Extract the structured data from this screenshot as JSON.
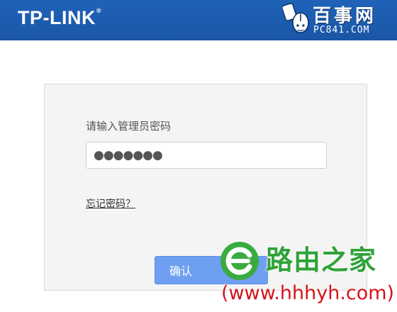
{
  "header": {
    "brand": "TP-LINK",
    "brand_mark": "®",
    "bg_color": "#1a56a6"
  },
  "watermark_top": {
    "icon": "mouse-icon",
    "title": "百事网",
    "subtitle": "PC841.COM"
  },
  "login": {
    "prompt": "请输入管理员密码",
    "password_value": "●●●●●●●",
    "forgot_link": "忘记密码？",
    "confirm_label": "确认",
    "confirm_color": "#6f9ff0"
  },
  "watermark_bottom": {
    "icon": "leaf-e-logo-icon",
    "name": "路由之家",
    "url": "(www.hhhyh.com)",
    "name_color": "#2fa238",
    "url_color": "#d6121b"
  }
}
